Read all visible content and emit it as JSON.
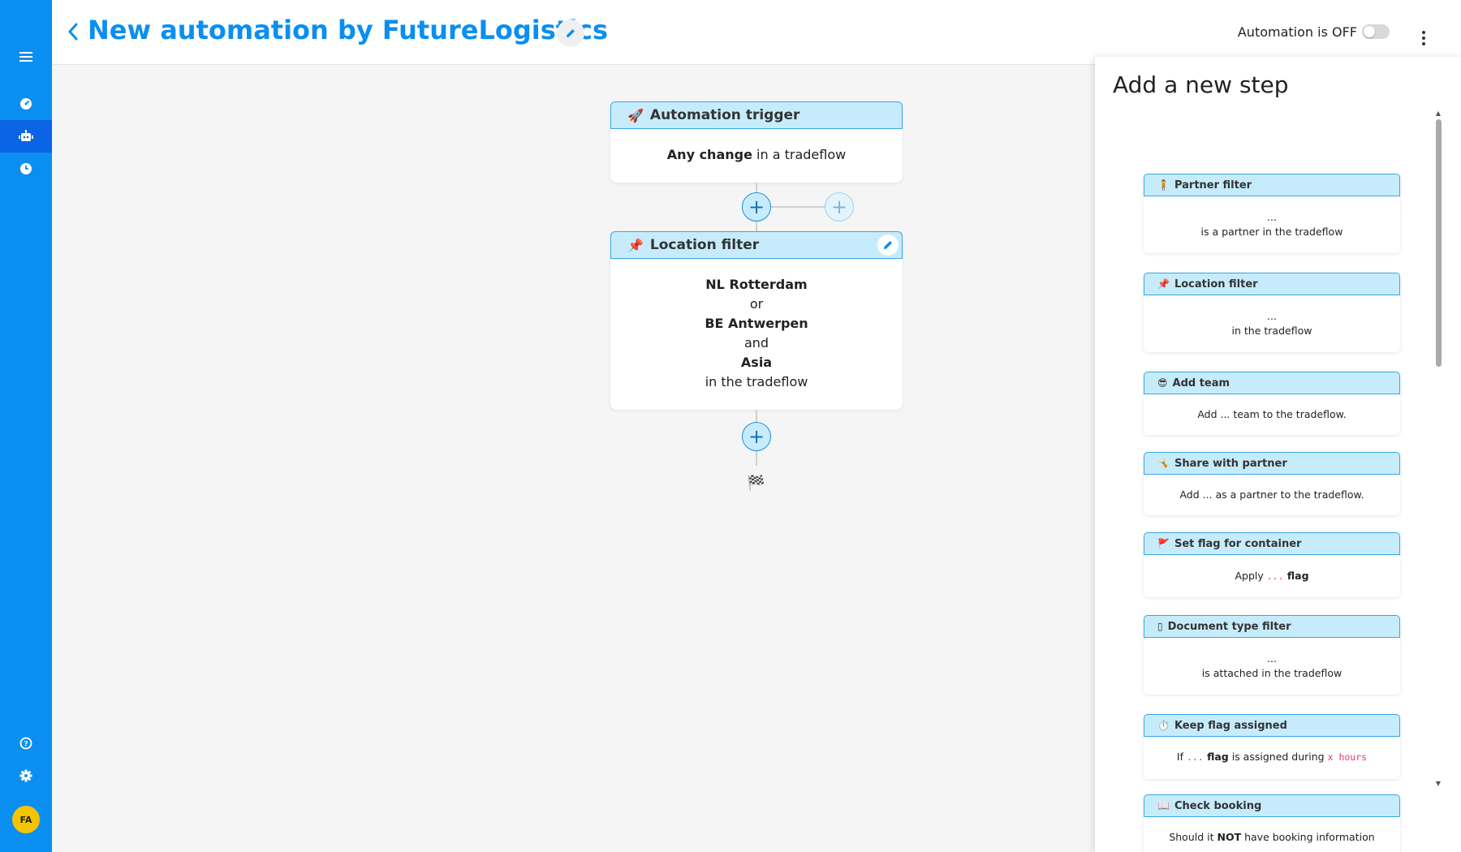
{
  "header": {
    "title": "New automation by FutureLogistics",
    "toggle_label": "Automation is OFF",
    "toggle_state": "off"
  },
  "sidebar": {
    "items": [
      {
        "icon": "menu-icon"
      },
      {
        "icon": "dashboard-icon"
      },
      {
        "icon": "robot-icon",
        "active": true
      },
      {
        "icon": "clock-icon"
      },
      {
        "icon": "help-icon"
      },
      {
        "icon": "gear-icon"
      }
    ],
    "avatar": "FA"
  },
  "flow": {
    "trigger": {
      "emoji": "🚀",
      "title": "Automation trigger",
      "body_bold": "Any change",
      "body_rest": " in a tradeflow"
    },
    "location": {
      "emoji": "📌",
      "title": "Location filter",
      "lines": [
        "NL Rotterdam",
        "or",
        "BE Antwerpen",
        "and",
        "Asia",
        "in the tradeflow"
      ]
    },
    "plus": "+",
    "finish": "🏁"
  },
  "panel": {
    "title": "Add a new step",
    "steps": [
      {
        "emoji": "🧍",
        "title": "Partner filter",
        "line1": "...",
        "line2": "is a partner in the tradeflow"
      },
      {
        "emoji": "📌",
        "title": "Location filter",
        "line1": "...",
        "line2": "in the tradeflow"
      },
      {
        "emoji": "😎",
        "title": "Add team",
        "line1": "Add ... team to the tradeflow."
      },
      {
        "emoji": "🤸",
        "title": "Share with partner",
        "line1": "Add ... as a partner to the tradeflow."
      },
      {
        "emoji": "🚩",
        "title": "Set flag for container",
        "pre": "Apply ",
        "dots": "...",
        "bold": " flag"
      },
      {
        "emoji": "▯",
        "title": "Document type filter",
        "line1": "...",
        "line2": "is attached in the tradeflow"
      },
      {
        "emoji": "⏱️",
        "title": "Keep flag assigned",
        "pre": "If ",
        "dots": "...",
        "bold": " flag",
        "mid": " is assigned during ",
        "code": "x hours"
      },
      {
        "emoji": "📖",
        "title": "Check booking",
        "pre": "Should it ",
        "bold": "NOT",
        "post": " have booking information"
      }
    ]
  }
}
